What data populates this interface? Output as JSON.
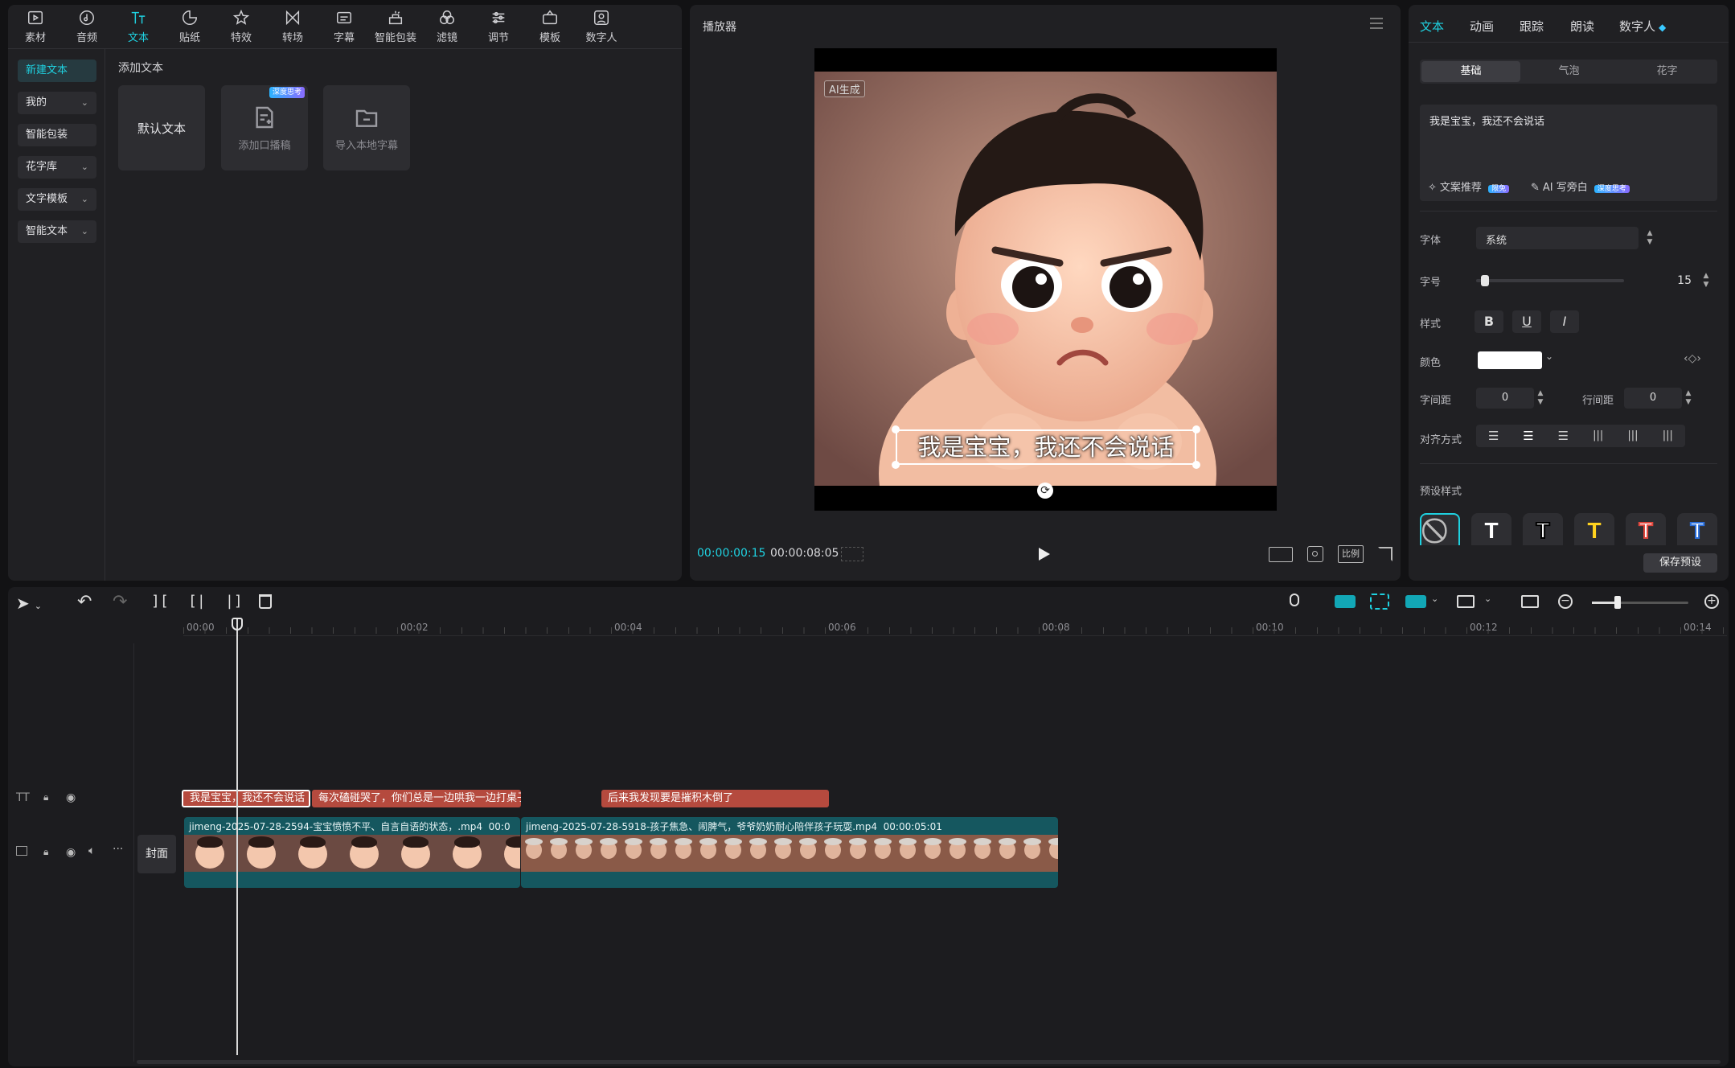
{
  "toolbar": {
    "tools": [
      {
        "label": "素材",
        "icon": "media-icon"
      },
      {
        "label": "音频",
        "icon": "audio-icon"
      },
      {
        "label": "文本",
        "icon": "text-icon"
      },
      {
        "label": "贴纸",
        "icon": "sticker-icon"
      },
      {
        "label": "特效",
        "icon": "effects-icon"
      },
      {
        "label": "转场",
        "icon": "transition-icon"
      },
      {
        "label": "字幕",
        "icon": "caption-icon"
      },
      {
        "label": "智能包装",
        "icon": "smart-pack-icon"
      },
      {
        "label": "滤镜",
        "icon": "filter-icon"
      },
      {
        "label": "调节",
        "icon": "adjust-icon"
      },
      {
        "label": "模板",
        "icon": "template-icon"
      },
      {
        "label": "数字人",
        "icon": "digital-human-icon"
      }
    ],
    "active_index": 2
  },
  "sidebar": {
    "items": [
      {
        "label": "新建文本"
      },
      {
        "label": "我的"
      },
      {
        "label": "智能包装"
      },
      {
        "label": "花字库"
      },
      {
        "label": "文字模板"
      },
      {
        "label": "智能文本"
      }
    ]
  },
  "library": {
    "section_title": "添加文本",
    "cards": [
      {
        "label": "默认文本"
      },
      {
        "label": "添加口播稿",
        "badge": "深度思考"
      },
      {
        "label": "导入本地字幕"
      }
    ]
  },
  "player": {
    "title": "播放器",
    "ai_tag": "AI生成",
    "subtitle": "我是宝宝，我还不会说话",
    "current_time": "00:00:00:15",
    "total_time": "00:00:08:05",
    "ratio_label": "比例"
  },
  "inspector": {
    "tabs": [
      "文本",
      "动画",
      "跟踪",
      "朗读",
      "数字人"
    ],
    "subtabs": [
      "基础",
      "气泡",
      "花字"
    ],
    "text_value": "我是宝宝，我还不会说话",
    "copy_suggest": "文案推荐",
    "copy_suggest_badge": "限免",
    "ai_write": "AI 写旁白",
    "ai_write_badge": "深度思考",
    "font_label": "字体",
    "font_value": "系统",
    "size_label": "字号",
    "size_value": "15",
    "size_fraction": 0.03,
    "style_label": "样式",
    "color_label": "颜色",
    "color_value": "#ffffff",
    "letter_spacing_label": "字间距",
    "letter_spacing_value": "0",
    "line_spacing_label": "行间距",
    "line_spacing_value": "0",
    "align_label": "对齐方式",
    "preset_label": "预设样式",
    "save_preset": "保存预设"
  },
  "timeline": {
    "ruler": [
      "00:00",
      "00:02",
      "00:04",
      "00:06",
      "00:08",
      "00:10",
      "00:12",
      "00:14"
    ],
    "text_clips": [
      {
        "text": "我是宝宝，我还不会说话"
      },
      {
        "text": "每次磕碰哭了，你们总是一边哄我一边打桌子"
      },
      {
        "text": "后来我发现要是摧积木倒了"
      }
    ],
    "cover_label": "封面",
    "video_clips": [
      {
        "title": "jimeng-2025-07-28-2594-宝宝愤愤不平、自言自语的状态，.mp4",
        "duration": "00:0"
      },
      {
        "title": "jimeng-2025-07-28-5918-孩子焦急、闹脾气，爷爷奶奶耐心陪伴孩子玩耍.mp4",
        "duration": "00:00:05:01"
      }
    ],
    "zoom_fraction": 0.27
  }
}
